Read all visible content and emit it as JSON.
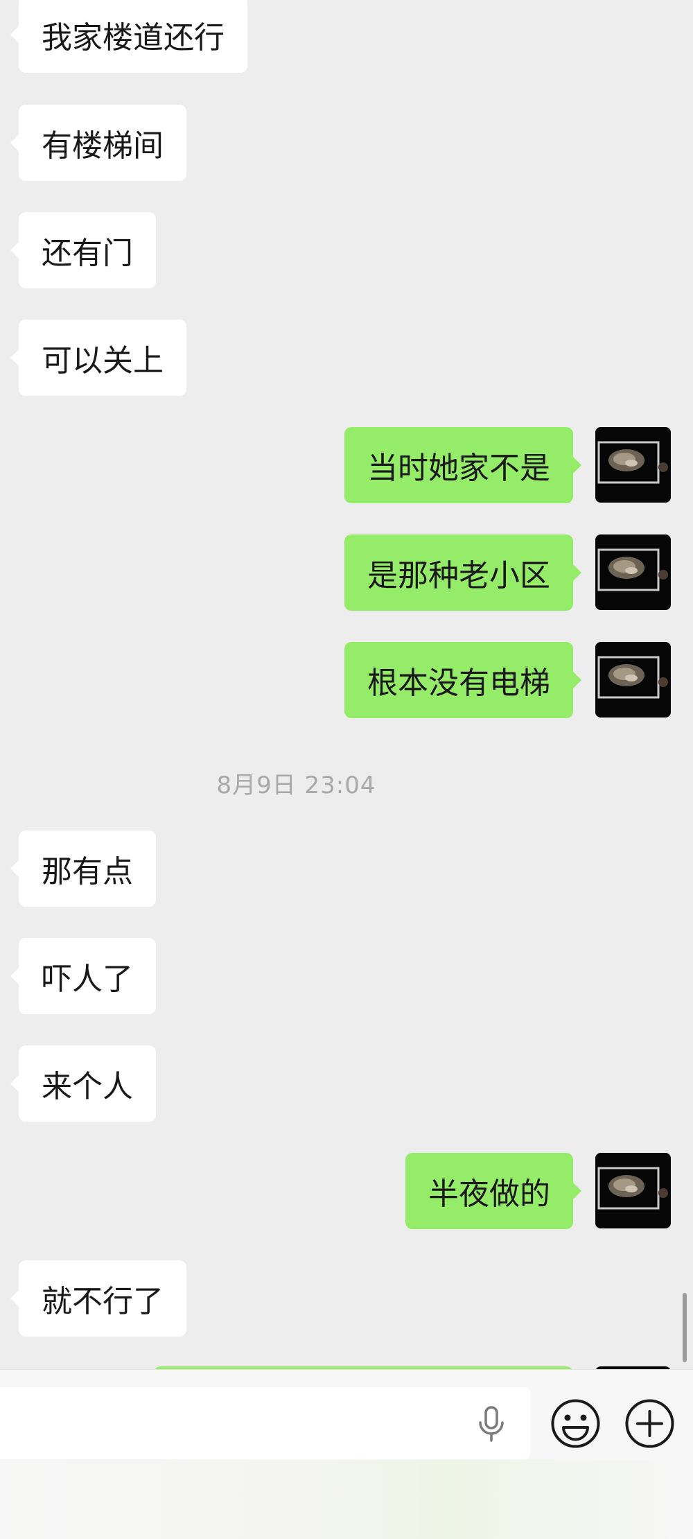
{
  "messages": [
    {
      "side": "left",
      "text": "我家楼道还行"
    },
    {
      "side": "left",
      "text": "有楼梯间"
    },
    {
      "side": "left",
      "text": "还有门"
    },
    {
      "side": "left",
      "text": "可以关上"
    },
    {
      "side": "right",
      "text": "当时她家不是"
    },
    {
      "side": "right",
      "text": "是那种老小区"
    },
    {
      "side": "right",
      "text": "根本没有电梯"
    },
    {
      "side": "left",
      "text": "那有点"
    },
    {
      "side": "left",
      "text": "吓人了"
    },
    {
      "side": "left",
      "text": "来个人"
    },
    {
      "side": "right",
      "text": "半夜做的"
    },
    {
      "side": "left",
      "text": "就不行了"
    }
  ],
  "timestamp": "8月9日 23:04",
  "input_bar": {
    "voice_icon": "microphone-icon",
    "emoji_icon": "smiley-icon",
    "more_icon": "plus-icon"
  },
  "colors": {
    "background": "#ededed",
    "sent_bubble": "#95ec69",
    "received_bubble": "#ffffff",
    "timestamp_text": "#a8a8a8"
  }
}
